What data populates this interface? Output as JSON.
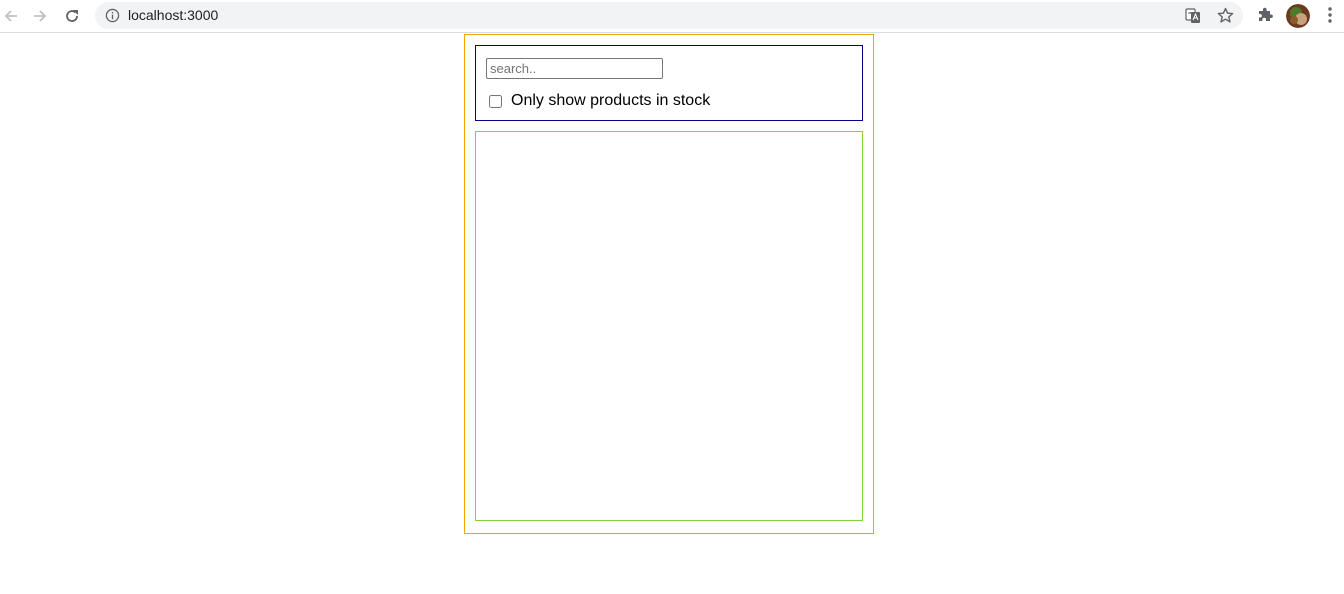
{
  "browser": {
    "url": "localhost:3000",
    "icons": {
      "back": "back-arrow-icon",
      "forward": "forward-arrow-icon",
      "reload": "reload-icon",
      "info": "info-icon",
      "translate": "translate-icon",
      "bookmark": "star-icon",
      "extensions": "puzzle-icon",
      "menu": "kebab-menu-icon"
    }
  },
  "app": {
    "search": {
      "placeholder": "search..",
      "value": ""
    },
    "stock_filter": {
      "label": "Only show products in stock",
      "checked": false
    }
  },
  "colors": {
    "container_border": "#f0a500",
    "search_bar_border": "#00008b",
    "product_table_border": "#7fd33f"
  }
}
